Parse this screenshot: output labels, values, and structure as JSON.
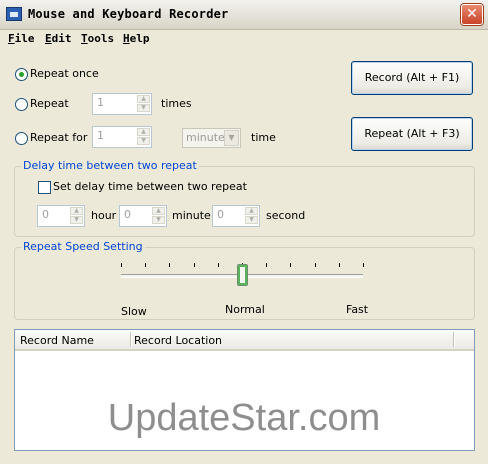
{
  "window": {
    "title": "Mouse and Keyboard Recorder",
    "close_glyph": "✕"
  },
  "menu": [
    {
      "key": "F",
      "rest": "ile"
    },
    {
      "key": "E",
      "rest": "dit"
    },
    {
      "key": "T",
      "rest": "ools"
    },
    {
      "key": "H",
      "rest": "elp"
    }
  ],
  "repeat": {
    "once_label": "Repeat once",
    "times_label": "Repeat",
    "times_value": "1",
    "times_unit": "times",
    "for_label": "Repeat for",
    "for_value": "1",
    "for_unit_selected": "minute",
    "time_label": "time",
    "selected": "once"
  },
  "buttons": {
    "record": "Record (Alt + F1)",
    "repeat": "Repeat (Alt + F3)"
  },
  "delay": {
    "group_title": "Delay time between two repeat",
    "checkbox_label": "Set delay time between two repeat",
    "checked": false,
    "hour_value": "0",
    "hour_label": "hour",
    "minute_value": "0",
    "minute_label": "minute",
    "second_value": "0",
    "second_label": "second"
  },
  "speed": {
    "group_title": "Repeat Speed Setting",
    "slow": "Slow",
    "normal": "Normal",
    "fast": "Fast",
    "level_fraction": 0.5,
    "tick_count": 11
  },
  "list": {
    "columns": [
      "Record Name",
      "Record Location"
    ],
    "rows": []
  },
  "watermark": "UpdateStar.com",
  "colors": {
    "group_title": "#0046d5",
    "radio_dot": "#2aa02a",
    "close_button": "#c8432a"
  }
}
